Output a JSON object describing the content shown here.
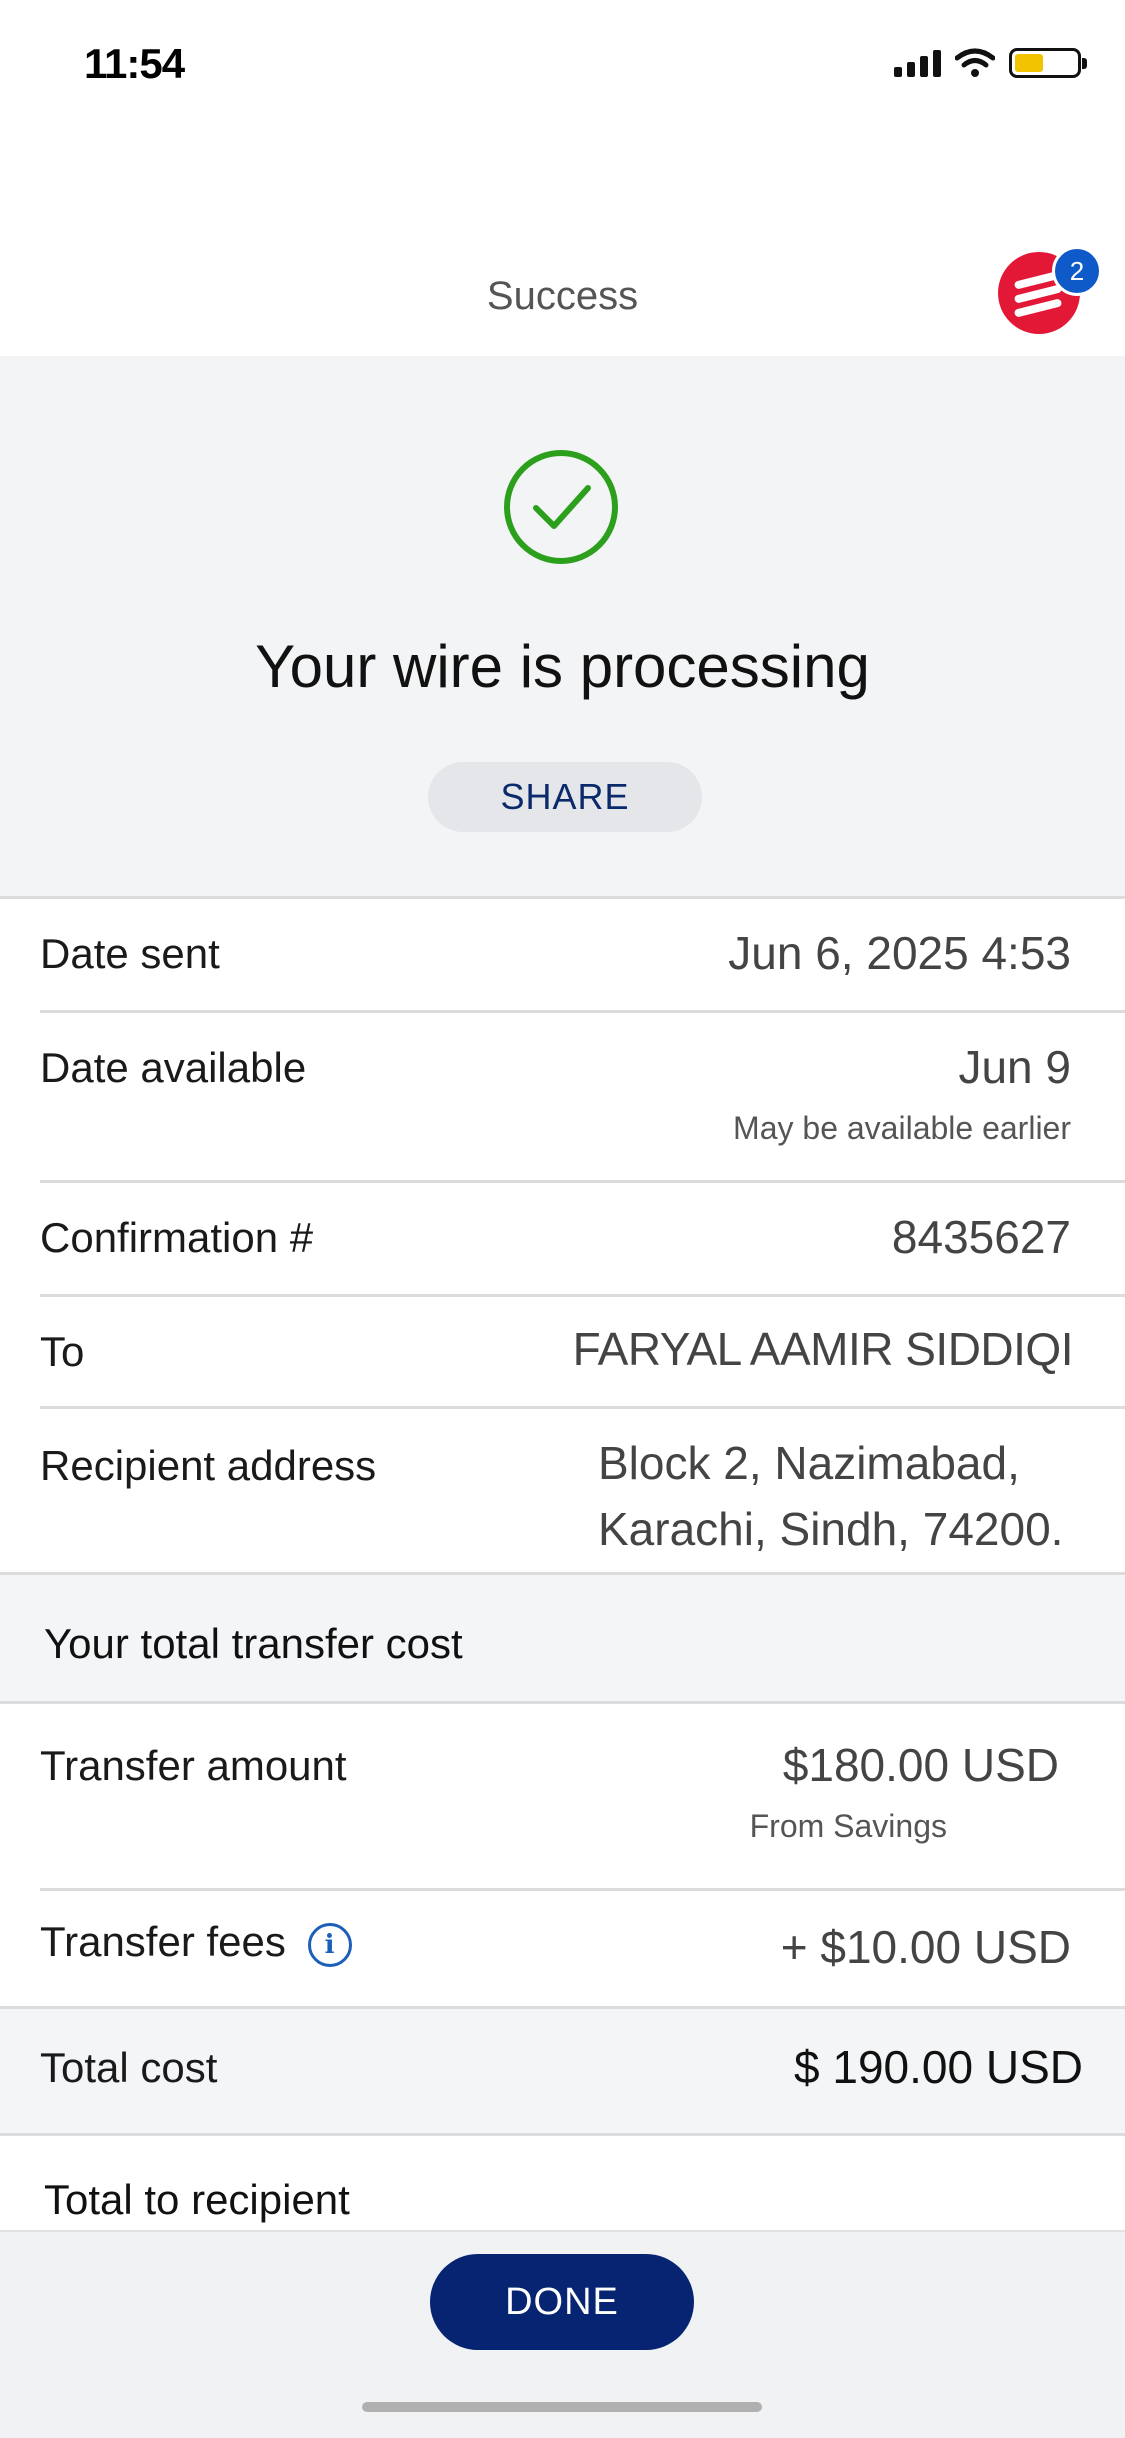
{
  "status_bar": {
    "time": "11:54"
  },
  "header": {
    "title": "Success",
    "notification_count": "2"
  },
  "hero": {
    "title": "Your wire is processing",
    "share_label": "SHARE"
  },
  "details": [
    {
      "label": "Date sent",
      "value": "Jun 6, 2025 4:53"
    },
    {
      "label": "Date available",
      "value": "Jun 9",
      "sub": "May be available earlier"
    },
    {
      "label": "Confirmation #",
      "value": "8435627"
    },
    {
      "label": "To",
      "value": "FARYAL AAMIR SIDDIQI"
    },
    {
      "label": "Recipient address",
      "value_line1": "Block 2, Nazimabad,",
      "value_line2": "Karachi, Sindh, 74200."
    }
  ],
  "cost": {
    "section_title": "Your total transfer cost",
    "transfer_amount_label": "Transfer amount",
    "transfer_amount_value": "$180.00 USD",
    "transfer_amount_source": "From Savings",
    "transfer_fees_label": "Transfer fees",
    "transfer_fees_value": "+ $10.00 USD",
    "total_cost_label": "Total cost",
    "total_cost_value": "$ 190.00 USD",
    "total_recipient_label": "Total to recipient"
  },
  "footer": {
    "done_label": "DONE"
  },
  "colors": {
    "brand_red": "#e31837",
    "navy": "#062471",
    "success_green": "#2ca01c",
    "link_blue": "#1b5fb8"
  }
}
